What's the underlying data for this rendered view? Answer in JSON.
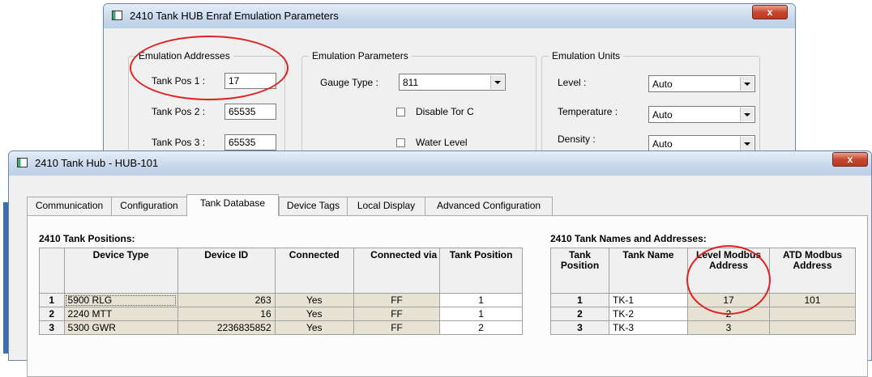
{
  "back_window": {
    "title": "2410 Tank HUB Enraf Emulation Parameters",
    "close_glyph": "x",
    "addresses": {
      "group_title": "Emulation Addresses",
      "fields": [
        {
          "label": "Tank Pos 1 :",
          "value": "17"
        },
        {
          "label": "Tank Pos 2 :",
          "value": "65535"
        },
        {
          "label": "Tank Pos 3 :",
          "value": "65535"
        }
      ]
    },
    "parameters": {
      "group_title": "Emulation Parameters",
      "gauge_type_label": "Gauge Type :",
      "gauge_type_value": "811",
      "disable_tor_c": "Disable Tor C",
      "water_level": "Water Level"
    },
    "units": {
      "group_title": "Emulation Units",
      "rows": [
        {
          "label": "Level :",
          "value": "Auto"
        },
        {
          "label": "Temperature :",
          "value": "Auto"
        },
        {
          "label": "Density :",
          "value": "Auto"
        }
      ]
    }
  },
  "front_window": {
    "title": "2410 Tank Hub  - HUB-101",
    "close_glyph": "x",
    "tabs": [
      "Communication",
      "Configuration",
      "Tank Database",
      "Device Tags",
      "Local Display",
      "Advanced Configuration"
    ],
    "active_tab": "Tank Database",
    "positions_title": "2410 Tank Positions:",
    "positions_headers": [
      "Device Type",
      "Device ID",
      "Connected",
      "Connected via",
      "Tank Position"
    ],
    "positions_rows": [
      {
        "n": "1",
        "type": "5900 RLG",
        "id": "263",
        "connected": "Yes",
        "via": "FF",
        "pos": "1"
      },
      {
        "n": "2",
        "type": "2240 MTT",
        "id": "16",
        "connected": "Yes",
        "via": "FF",
        "pos": "1"
      },
      {
        "n": "3",
        "type": "5300 GWR",
        "id": "2236835852",
        "connected": "Yes",
        "via": "FF",
        "pos": "2"
      }
    ],
    "names_title": "2410 Tank Names and Addresses:",
    "names_headers": [
      "Tank Position",
      "Tank Name",
      "Level Modbus Address",
      "ATD Modbus Address"
    ],
    "names_rows": [
      {
        "pos": "1",
        "name": "TK-1",
        "level": "17",
        "atd": "101"
      },
      {
        "pos": "2",
        "name": "TK-2",
        "level": "2",
        "atd": ""
      },
      {
        "pos": "3",
        "name": "TK-3",
        "level": "3",
        "atd": ""
      }
    ]
  },
  "colors": {
    "highlight_circle": "#e02020",
    "readonly_cell": "#e6e3d5"
  }
}
